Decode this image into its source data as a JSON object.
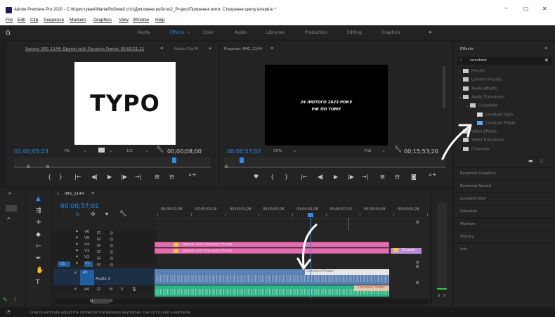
{
  "window": {
    "title": "Adobe Premiere Pro 2020 - C:\\Користувачі\\Marta\\Робочий стіл\\Дипломна робота\\2_Project\\Приречені жити. Створення циклу інтерв'ю *",
    "minimize": "–",
    "maximize": "▢",
    "close": "✕"
  },
  "menu": [
    "File",
    "Edit",
    "Clip",
    "Sequence",
    "Markers",
    "Graphics",
    "View",
    "Window",
    "Help"
  ],
  "workspaces": [
    "Marta",
    "Effects",
    "Color",
    "Audio",
    "Libraries",
    "Production",
    "Editing",
    "Graphics"
  ],
  "workspaces_more": "»",
  "source": {
    "tab": "Source: IMG_1144: Opener with Dynamic Frame: 00;00;51;11",
    "menu": "≡",
    "tab2": "Audio Clip M",
    "more": "»",
    "frame_text": "TYPO",
    "timecode": "01;00;05;23",
    "fit": "Fit",
    "resolution": "1/2",
    "duration": "00;00;08;00"
  },
  "program": {
    "tab": "Program: IMG_1144",
    "menu": "≡",
    "line1": "24 ЛЮТОГО 2023 РОКУ",
    "line2": "РІК ПО ТОМУ",
    "timecode": "00;00;57;02",
    "zoom": "50%",
    "quality": "Full",
    "duration": "00;15;53;26"
  },
  "effects": {
    "title": "Effects",
    "menu": "≡",
    "search_value": "constant",
    "clear": "✕",
    "items": [
      {
        "label": "Presets",
        "level": 0,
        "kind": "star-folder"
      },
      {
        "label": "Lumetri Presets",
        "level": 0,
        "kind": "star-folder"
      },
      {
        "label": "Audio Effects",
        "level": 0,
        "kind": "folder"
      },
      {
        "label": "Audio Transitions",
        "level": 0,
        "kind": "folder",
        "open": true
      },
      {
        "label": "Crossfade",
        "level": 1,
        "kind": "folder",
        "open": true
      },
      {
        "label": "Constant Gain",
        "level": 2,
        "kind": "effect"
      },
      {
        "label": "Constant Power",
        "level": 2,
        "kind": "effect",
        "selected": true
      },
      {
        "label": "Video Effects",
        "level": 0,
        "kind": "folder"
      },
      {
        "label": "Video Transitions",
        "level": 0,
        "kind": "folder"
      },
      {
        "label": "Плагины",
        "level": 0,
        "kind": "folder"
      }
    ],
    "other_panels": [
      "Essential Graphics",
      "Essential Sound",
      "Lumetri Color",
      "Libraries",
      "Markers",
      "History",
      "Info"
    ]
  },
  "timeline": {
    "tab": "IMG_1144",
    "menu": "≡",
    "close": "×",
    "timecode": "00;00;57;02",
    "ruler": [
      "00;00;52;28",
      "00;00;53;28",
      "00;00;54;28",
      "00;00;55;28",
      "00;00;56;28",
      "00;00;57;28",
      "00;00;58;28",
      "00;00;59;28"
    ],
    "video_tracks": [
      "V6",
      "V5",
      "V4",
      "V3",
      "V2",
      "V1"
    ],
    "source_v": "V1",
    "audio_tracks": [
      "A3",
      "A4"
    ],
    "audio3_name": "Audio 3",
    "mute": "M",
    "solo": "S",
    "clip_v4": "Opener with Dynamic Frame",
    "clip_v3": "Opener with Dynamic Frame",
    "clip_right": "Пожеж",
    "transition_a3": "Constant Power",
    "transition_a4": "Constant Power",
    "meter_labels": [
      "S",
      "S"
    ]
  },
  "status": {
    "text": "Drag to vertically adjust the connector line between keyframes. Use Ctrl to add a keyframe."
  },
  "colors": {
    "accent": "#2d8ceb",
    "clip_pink": "#e26fad",
    "audio_green": "#2bb487",
    "audio_blue": "#5b80b3"
  }
}
